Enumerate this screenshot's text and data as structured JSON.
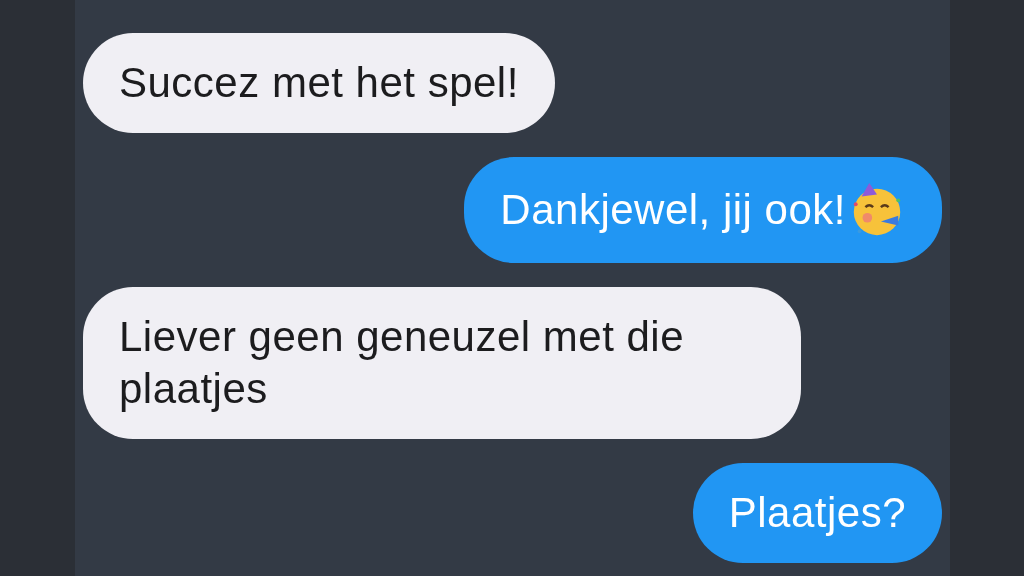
{
  "messages": [
    {
      "outgoing": false,
      "text": "Succez met het spel!",
      "emoji": false
    },
    {
      "outgoing": true,
      "text": "Dankjewel, jij ook!",
      "emoji": true
    },
    {
      "outgoing": false,
      "text": "Liever geen geneuzel met die plaatjes",
      "emoji": false
    },
    {
      "outgoing": true,
      "text": "Plaatjes?",
      "emoji": false
    }
  ]
}
